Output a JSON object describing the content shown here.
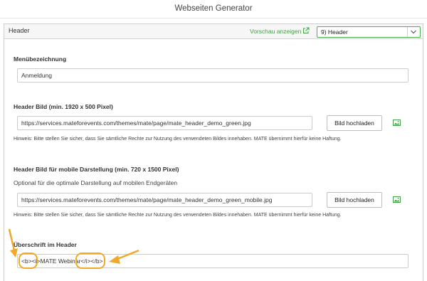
{
  "app": {
    "title": "Webseiten Generator"
  },
  "header_bar": {
    "title": "Header",
    "preview_link": "Vorschau anzeigen",
    "select_value": "9) Header"
  },
  "menu": {
    "label": "Menübezeichnung",
    "value": "Anmeldung"
  },
  "header_image": {
    "label": "Header Bild (min. 1920 x 500 Pixel)",
    "value": "https://services.mateforevents.com/themes/mate/page/mate_header_demo_green.jpg",
    "upload_label": "Bild hochladen",
    "hint": "Hinweis: Bitte stellen Sie sicher, dass Sie sämtliche Rechte zur Nutzung des verwendeten Bildes innehaben. MATE übernimmt hierfür keine Haftung."
  },
  "mobile_image": {
    "label": "Header Bild für mobile Darstellung (min. 720 x 1500 Pixel)",
    "sublabel": "Optional für die optimale Darstellung auf mobilen Endgeräten",
    "value": "https://services.mateforevents.com/themes/mate/page/mate_header_demo_green_mobile.jpg",
    "upload_label": "Bild hochladen",
    "hint": "Hinweis: Bitte stellen Sie sicher, dass Sie sämtliche Rechte zur Nutzung des verwendeten Bildes innehaben. MATE übernimmt hierfür keine Haftung."
  },
  "headline": {
    "label": "Überschrift im Header",
    "value": "<b><i>MATE Webinar</i></b>"
  },
  "colors": {
    "accent_green": "#43a047",
    "annotation_orange": "#f0a82a"
  },
  "icons": {
    "external_link": "external-link-icon",
    "chevron": "chevron-down-icon",
    "image": "image-icon",
    "annotation": "arrow-annotation"
  }
}
